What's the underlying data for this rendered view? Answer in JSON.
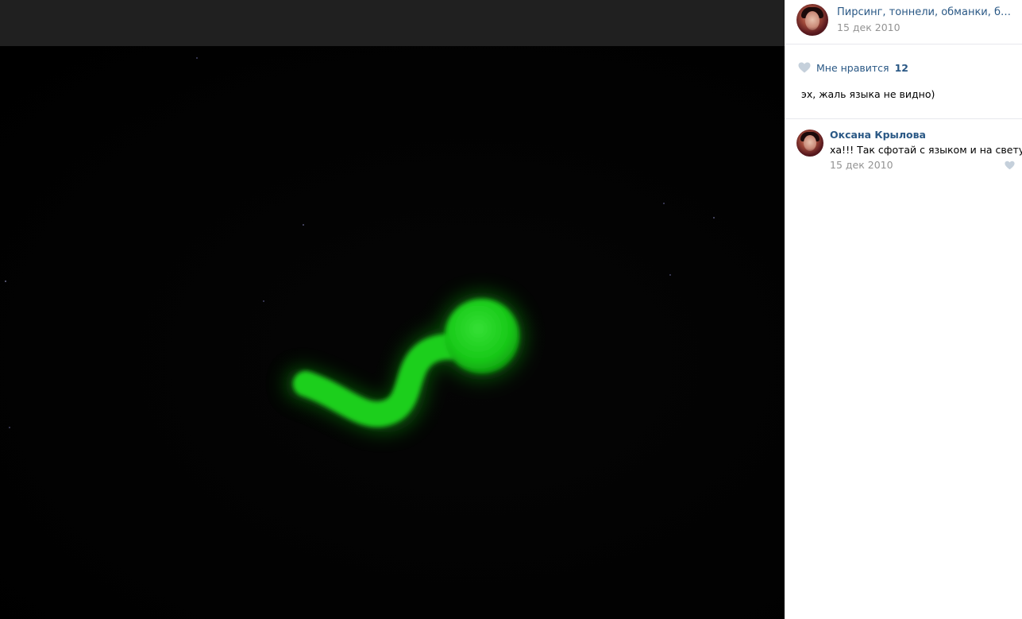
{
  "post": {
    "group_name": "Пирсинг, тоннели, обманки, бижут...",
    "date": "15 дек 2010",
    "likes_label": "Мне нравится",
    "likes_count": "12",
    "text": "эх, жаль языка не видно)"
  },
  "comment": {
    "author": "Оксана Крылова",
    "text": "ха!!! Так сфотай с языком и на свету))",
    "date": "15 дек 2010"
  },
  "colors": {
    "link": "#2a5885",
    "glow": "#1fd51f",
    "heart": "#c5d0db"
  },
  "icons": {
    "like": "heart-icon",
    "comment_like": "heart-icon"
  }
}
